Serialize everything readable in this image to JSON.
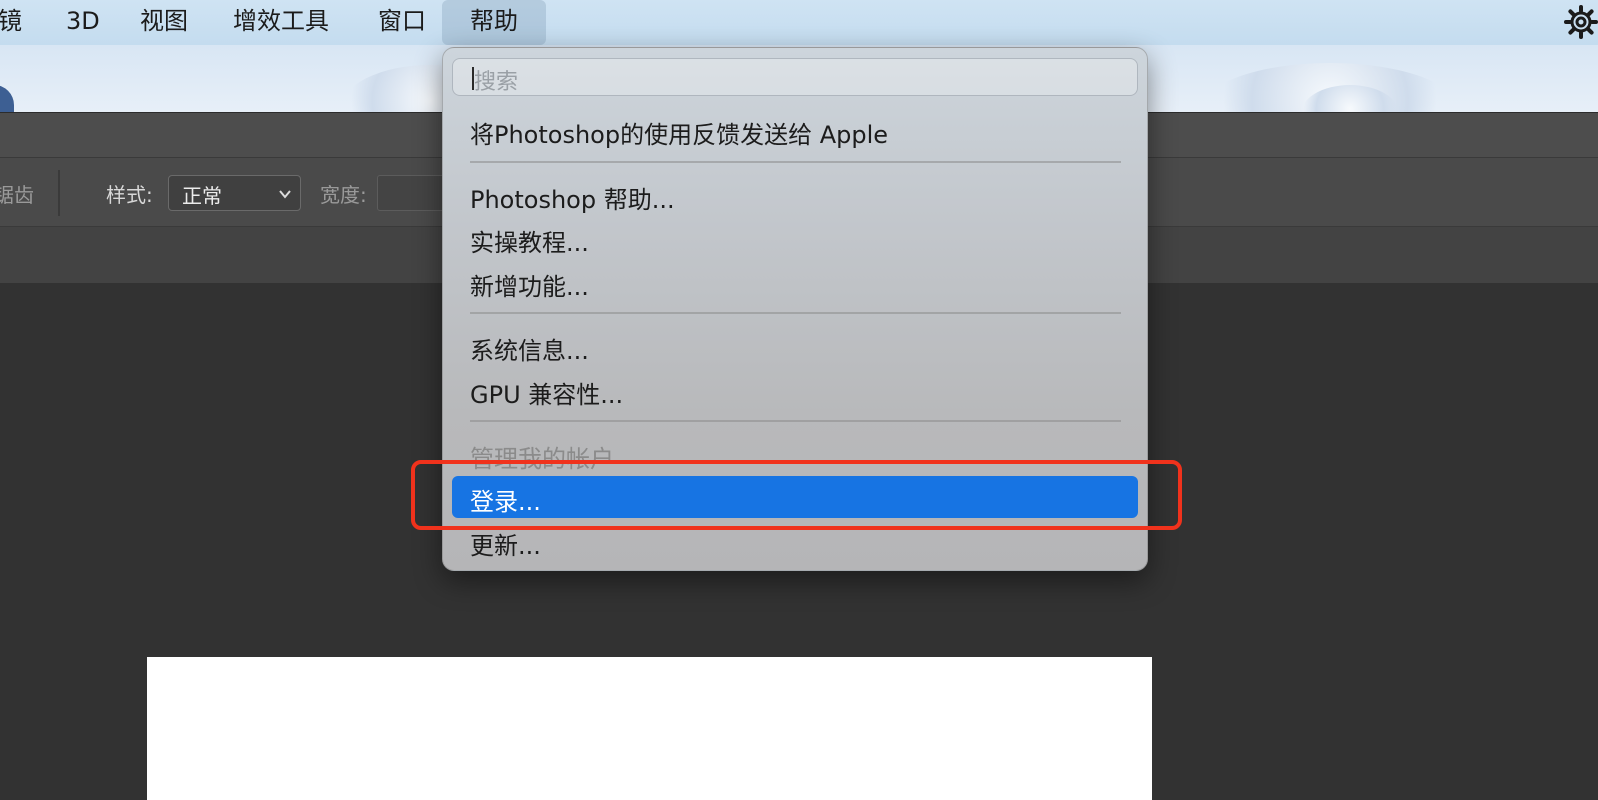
{
  "menubar": {
    "items": [
      {
        "label": "镜"
      },
      {
        "label": "3D"
      },
      {
        "label": "视图"
      },
      {
        "label": "增效工具"
      },
      {
        "label": "窗口"
      },
      {
        "label": "帮助",
        "active": true
      }
    ],
    "right_icon": "gear-icon"
  },
  "options_bar": {
    "antialias_label": "锯齿",
    "style_label": "样式:",
    "style_value": "正常",
    "width_label": "宽度:"
  },
  "help_menu": {
    "search_placeholder": "搜索",
    "items": [
      {
        "label": "将Photoshop的使用反馈发送给 Apple",
        "enabled": true
      },
      {
        "label": "Photoshop 帮助...",
        "enabled": true
      },
      {
        "label": "实操教程...",
        "enabled": true
      },
      {
        "label": "新增功能...",
        "enabled": true
      },
      {
        "label": "系统信息...",
        "enabled": true
      },
      {
        "label": "GPU 兼容性...",
        "enabled": true
      },
      {
        "label": "管理我的帐户",
        "enabled": false
      },
      {
        "label": "登录...",
        "enabled": true,
        "highlighted": true
      },
      {
        "label": "更新...",
        "enabled": true
      }
    ]
  },
  "colors": {
    "highlight": "#1774e3",
    "annotation": "#f0321c",
    "canvas_bg": "#323232"
  }
}
